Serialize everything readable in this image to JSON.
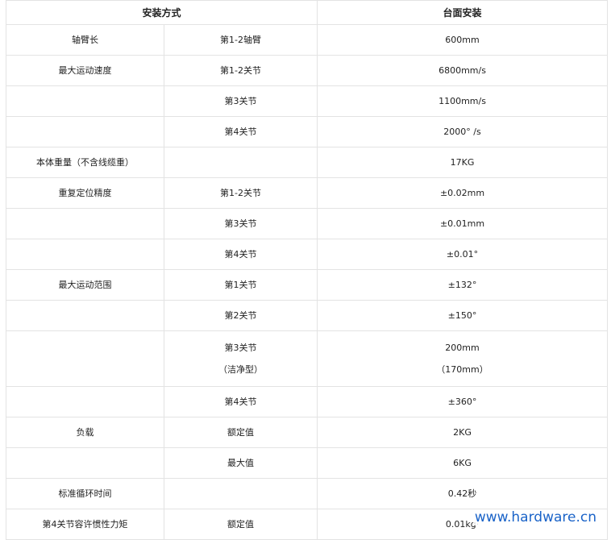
{
  "header": {
    "col1": "安装方式",
    "col2": "台面安装"
  },
  "rows": [
    {
      "label": "轴臂长",
      "sub": "第1-2轴臂",
      "value": "600mm"
    },
    {
      "label": "最大运动速度",
      "sub": "第1-2关节",
      "value": "6800mm/s"
    },
    {
      "label": "",
      "sub": "第3关节",
      "value": "1100mm/s"
    },
    {
      "label": "",
      "sub": "第4关节",
      "value": "2000° /s"
    },
    {
      "label": "本体重量（不含线缆重）",
      "sub": "",
      "value": "17KG"
    },
    {
      "label": "重复定位精度",
      "sub": "第1-2关节",
      "value": "±0.02mm"
    },
    {
      "label": "",
      "sub": "第3关节",
      "value": "±0.01mm"
    },
    {
      "label": "",
      "sub": "第4关节",
      "value": "±0.01°"
    },
    {
      "label": "最大运动范围",
      "sub": "第1关节",
      "value": "±132°"
    },
    {
      "label": "",
      "sub": "第2关节",
      "value": "±150°"
    },
    {
      "label": "",
      "sub": "第3关节",
      "sub2": "（洁净型）",
      "value": "200mm",
      "value2": "（170mm）"
    },
    {
      "label": "",
      "sub": "第4关节",
      "value": "±360°"
    },
    {
      "label": "负载",
      "sub": "额定值",
      "value": "2KG"
    },
    {
      "label": "",
      "sub": "最大值",
      "value": "6KG"
    },
    {
      "label": "标准循环时间",
      "sub": "",
      "value": "0.42秒"
    },
    {
      "label": "第4关节容许惯性力矩",
      "sub": "额定值",
      "value": "0.01kg·"
    }
  ],
  "watermark": "www.hardware.cn"
}
